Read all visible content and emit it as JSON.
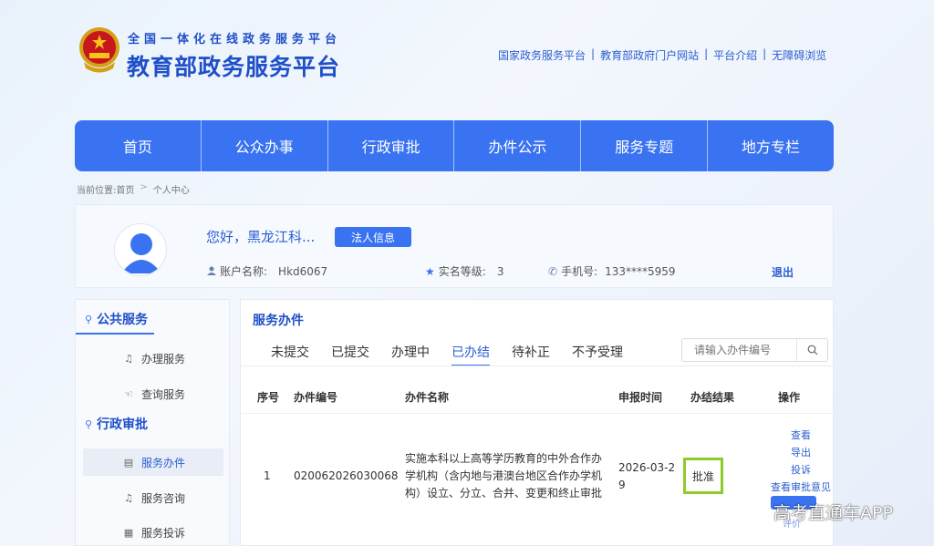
{
  "header": {
    "subtitle": "全国一体化在线政务服务平台",
    "title": "教育部政务服务平台",
    "links": [
      "国家政务服务平台",
      "教育部政府门户网站",
      "平台介绍",
      "无障碍浏览"
    ],
    "link_separator": "|"
  },
  "nav": {
    "items": [
      "首页",
      "公众办事",
      "行政审批",
      "办件公示",
      "服务专题",
      "地方专栏"
    ]
  },
  "breadcrumb": {
    "prefix": "当前位置:",
    "items": [
      "首页",
      "个人中心"
    ],
    "separator": ">"
  },
  "profile": {
    "greeting": "您好，黑龙江科...",
    "legal_button": "法人信息",
    "account_label": "账户名称:",
    "account_value": "Hkd6067",
    "level_label": "实名等级:",
    "level_value": "3",
    "phone_label": "手机号:",
    "phone_value": "133****5959",
    "logout": "退出"
  },
  "sidebar": {
    "section1_title": "公共服务",
    "section1_items": [
      "办理服务",
      "查询服务"
    ],
    "section2_title": "行政审批",
    "section2_items": [
      "服务办件",
      "服务咨询",
      "服务投诉"
    ]
  },
  "main": {
    "title": "服务办件",
    "tabs": [
      "未提交",
      "已提交",
      "办理中",
      "已办结",
      "待补正",
      "不予受理"
    ],
    "active_tab": "已办结",
    "search_placeholder": "请输入办件编号",
    "columns": [
      "序号",
      "办件编号",
      "办件名称",
      "申报时间",
      "办结结果",
      "操作"
    ],
    "rows": [
      {
        "index": "1",
        "number": "020062026030068",
        "name_lines": [
          "实施本科以上高等学历教育的中外合作办",
          "学机构（含内地与港澳台地区合作办学机",
          "构）设立、分立、合并、变更和终止审批"
        ],
        "date_lines": [
          "2026-03-2",
          "9"
        ],
        "result": "批准",
        "operations": [
          "查看",
          "导出",
          "投诉",
          "查看审批意见"
        ],
        "eval": "评价"
      }
    ]
  },
  "watermark": "高考直通车APP",
  "colors": {
    "primary": "#3a73f1",
    "title_blue": "#1f4fc9",
    "highlight_green": "#8ccc2a"
  }
}
